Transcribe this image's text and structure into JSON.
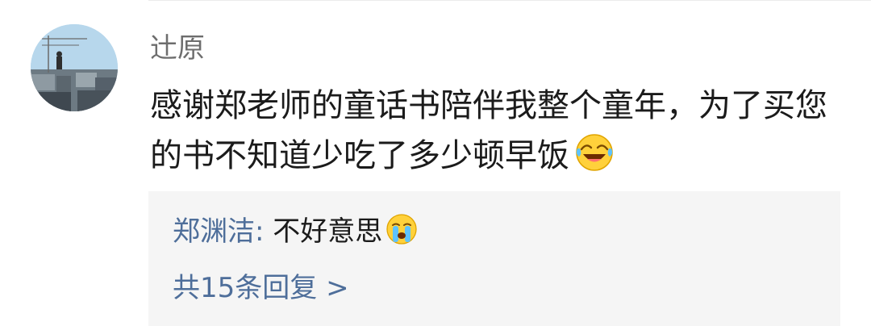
{
  "comment": {
    "username": "辻原",
    "text": "感谢郑老师的童话书陪伴我整个童年，为了买您的书不知道少吃了多少顿早饭",
    "emoji": "laughing-crying-emoji"
  },
  "reply_preview": {
    "author": "郑渊洁",
    "separator": ":",
    "text": "不好意思",
    "emoji": "crying-emoji",
    "view_all_label": "共15条回复 >"
  },
  "colors": {
    "link_blue": "#4e6e9a",
    "username_gray": "#6d6d6d",
    "text_dark": "#1b1b1b",
    "reply_bg": "#f5f5f5"
  }
}
